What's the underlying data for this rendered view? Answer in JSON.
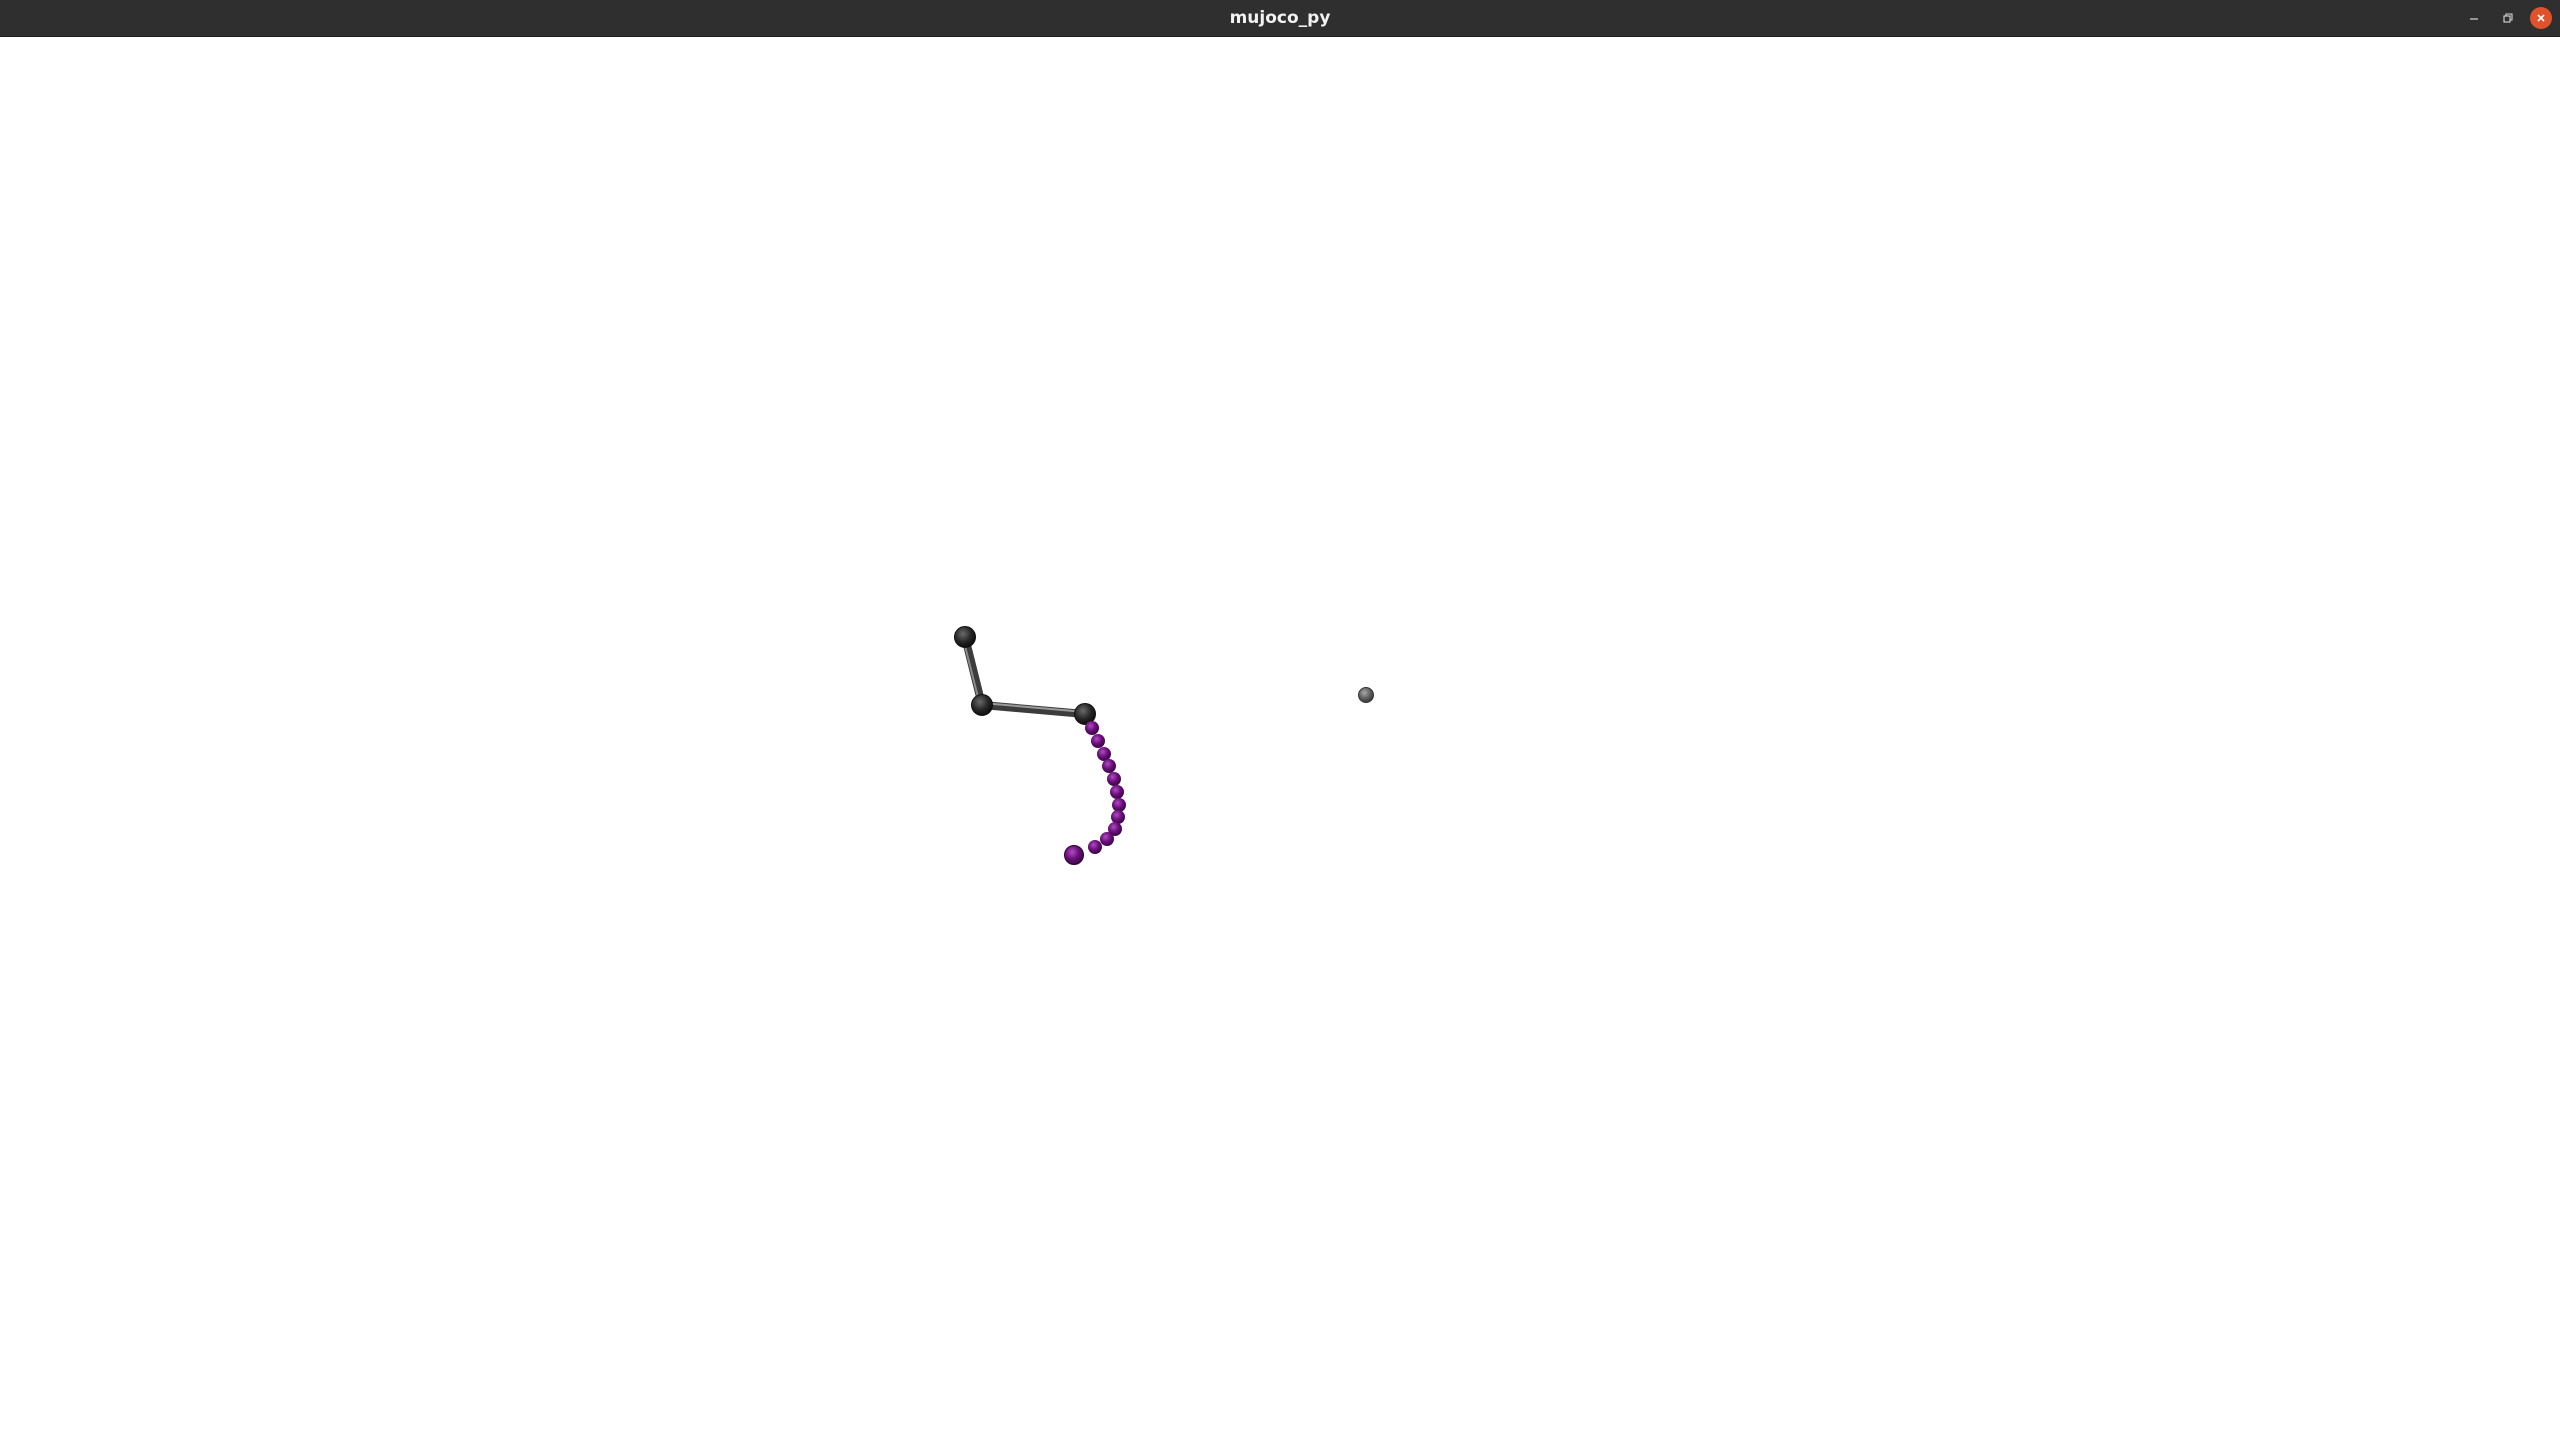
{
  "window": {
    "title": "mujoco_py",
    "controls": {
      "minimize_icon": "minimize-icon",
      "maximize_icon": "restore-icon",
      "close_icon": "close-icon"
    }
  },
  "scene": {
    "background_color": "#ffffff",
    "arm_link_color": "#5a5a5a",
    "joint_color": "#222222",
    "rope_color": "#6a0f7a",
    "target_color": "#666666"
  },
  "colors": {
    "titlebar": "#2f2f2f",
    "title_text": "#f2f2f2",
    "close_button": "#e0532a"
  }
}
